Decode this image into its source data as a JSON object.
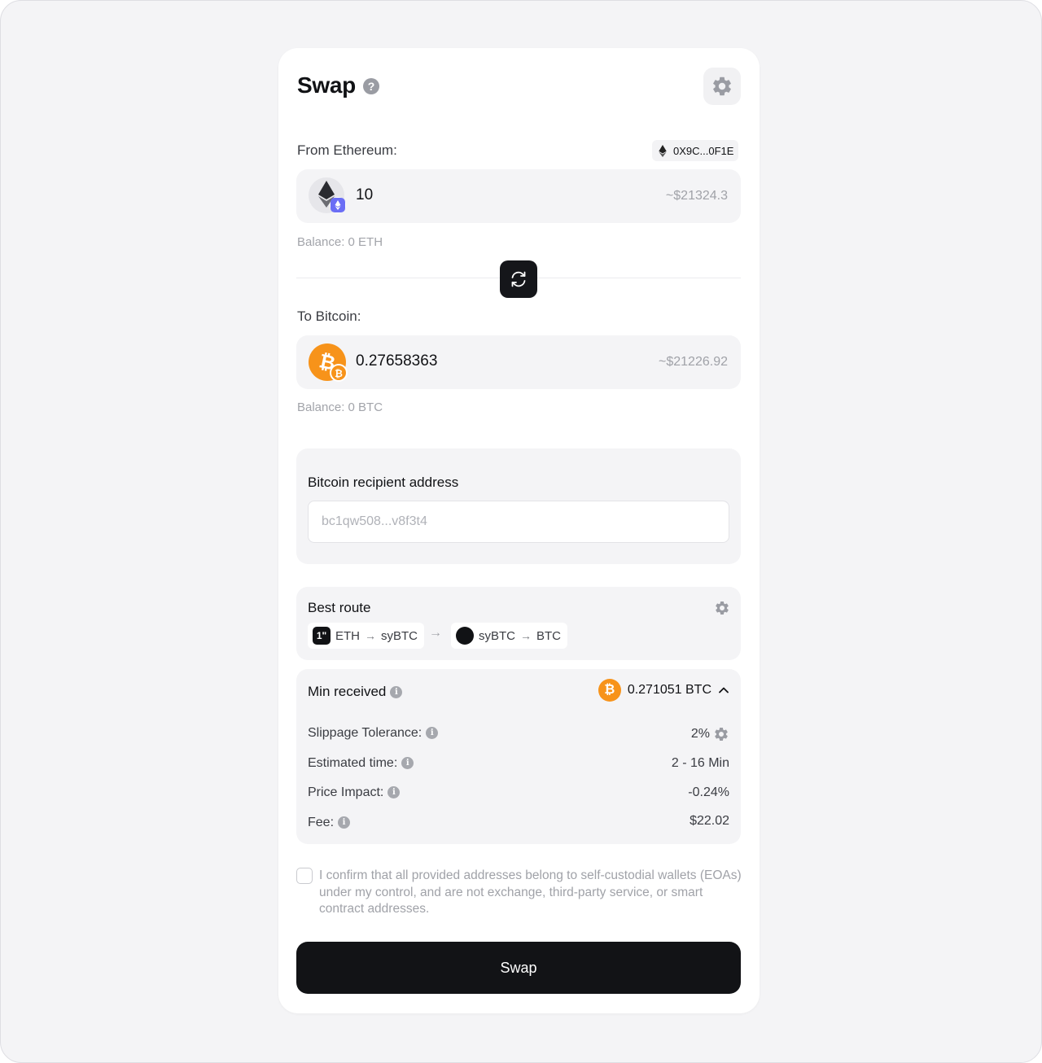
{
  "header": {
    "title": "Swap",
    "help_glyph": "?"
  },
  "from": {
    "label": "From Ethereum:",
    "wallet_address": "0X9C...0F1E",
    "amount": "10",
    "usd_value": "~$21324.3",
    "balance": "Balance: 0 ETH",
    "token_icon": "ethereum-icon"
  },
  "to": {
    "label": "To Bitcoin:",
    "amount": "0.27658363",
    "usd_value": "~$21226.92",
    "balance": "Balance: 0 BTC",
    "token_icon": "bitcoin-icon"
  },
  "recipient": {
    "title": "Bitcoin recipient address",
    "value": "bc1qw508...v8f3t4"
  },
  "route": {
    "title": "Best route",
    "steps": [
      {
        "provider_logo": "1\"",
        "from": "ETH",
        "to": "syBTC"
      },
      {
        "provider_logo": "",
        "from": "syBTC",
        "to": "BTC"
      }
    ],
    "arrow": "→"
  },
  "summary": {
    "min_received_label": "Min received",
    "min_received_value": "0.271051 BTC",
    "rows": [
      {
        "label": "Slippage Tolerance:",
        "value": "2%"
      },
      {
        "label": "Estimated time:",
        "value": "2 - 16 Min"
      },
      {
        "label": "Price Impact:",
        "value": "-0.24%"
      },
      {
        "label": "Fee:",
        "value": "$22.02"
      }
    ]
  },
  "confirm": {
    "text": "I confirm that all provided addresses belong to self-custodial wallets (EOAs) under my control, and are not exchange, third-party service, or smart contract addresses.",
    "checked": false
  },
  "swap_button": "Swap",
  "colors": {
    "bitcoin": "#f7931a",
    "ethereum_badge": "#6b6ef5",
    "primary_button": "#121316",
    "muted_text": "#a0a2a8"
  }
}
